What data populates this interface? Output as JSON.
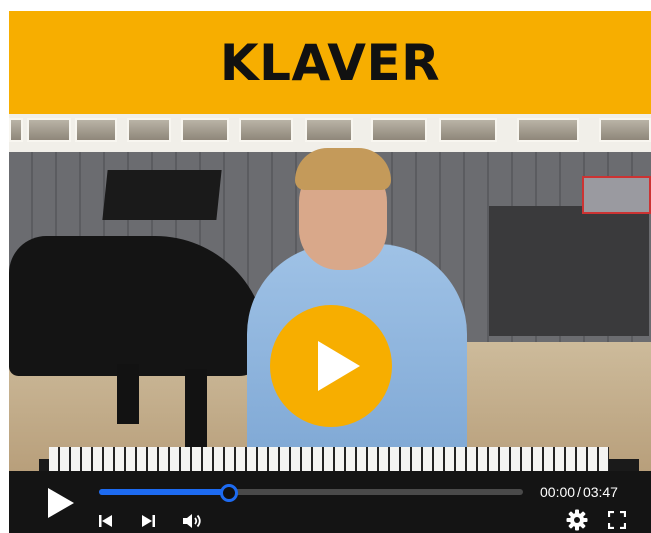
{
  "title": "KLAVER",
  "colors": {
    "accent": "#f7ae00",
    "progress": "#1d6bf2",
    "control_bar": "#141414"
  },
  "player": {
    "big_play_icon": "play-icon",
    "progress_fraction": 0.306,
    "current_time": "00:00",
    "time_separator": "/",
    "duration": "03:47",
    "icons": {
      "play": "play-icon",
      "previous": "skip-previous-icon",
      "next": "skip-next-icon",
      "volume": "volume-icon",
      "settings": "gear-icon",
      "fullscreen": "fullscreen-icon"
    }
  }
}
